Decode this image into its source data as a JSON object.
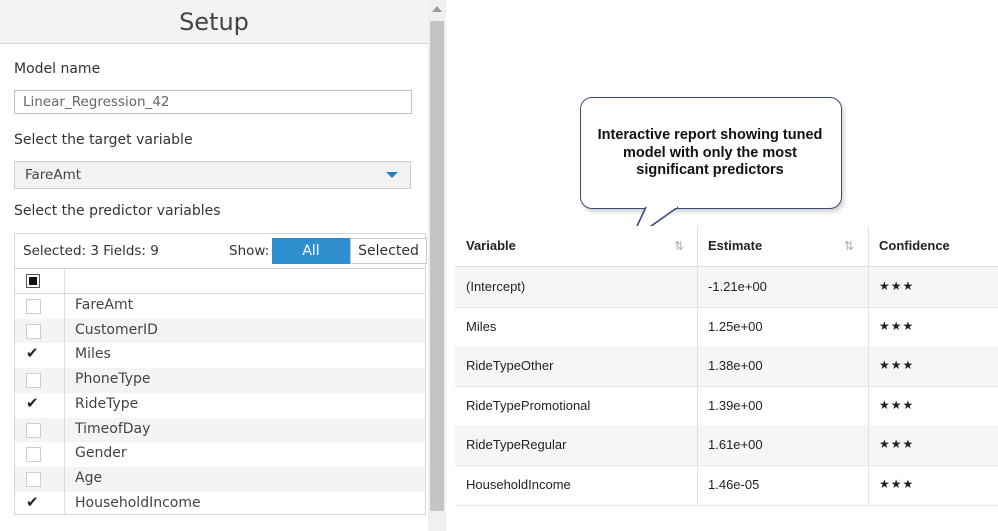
{
  "setup": {
    "title": "Setup",
    "model_name_label": "Model name",
    "model_name_value": "Linear_Regression_42",
    "target_label": "Select the target variable",
    "target_value": "FareAmt",
    "predictor_label": "Select the predictor variables",
    "selected_count": "Selected: 3 Fields: 9",
    "show_label": "Show:",
    "toggle_all": "All",
    "toggle_selected": "Selected",
    "fields": [
      {
        "name": "FareAmt",
        "checked": false
      },
      {
        "name": "CustomerID",
        "checked": false
      },
      {
        "name": "Miles",
        "checked": true
      },
      {
        "name": "PhoneType",
        "checked": false
      },
      {
        "name": "RideType",
        "checked": true
      },
      {
        "name": "TimeofDay",
        "checked": false
      },
      {
        "name": "Gender",
        "checked": false
      },
      {
        "name": "Age",
        "checked": false
      },
      {
        "name": "HouseholdIncome",
        "checked": true
      }
    ]
  },
  "callout": {
    "text": "Interactive report showing tuned model with only the most significant predictors"
  },
  "report": {
    "headers": {
      "variable": "Variable",
      "estimate": "Estimate",
      "confidence": "Confidence"
    },
    "rows": [
      {
        "variable": "(Intercept)",
        "estimate": "-1.21e+00",
        "confidence": "★★★"
      },
      {
        "variable": "Miles",
        "estimate": "1.25e+00",
        "confidence": "★★★"
      },
      {
        "variable": "RideTypeOther",
        "estimate": "1.38e+00",
        "confidence": "★★★"
      },
      {
        "variable": "RideTypePromotional",
        "estimate": "1.39e+00",
        "confidence": "★★★"
      },
      {
        "variable": "RideTypeRegular",
        "estimate": "1.61e+00",
        "confidence": "★★★"
      },
      {
        "variable": "HouseholdIncome",
        "estimate": "1.46e-05",
        "confidence": "★★★"
      }
    ]
  },
  "colors": {
    "accent": "#2d8fce",
    "callout_border": "#3a4a7a"
  }
}
